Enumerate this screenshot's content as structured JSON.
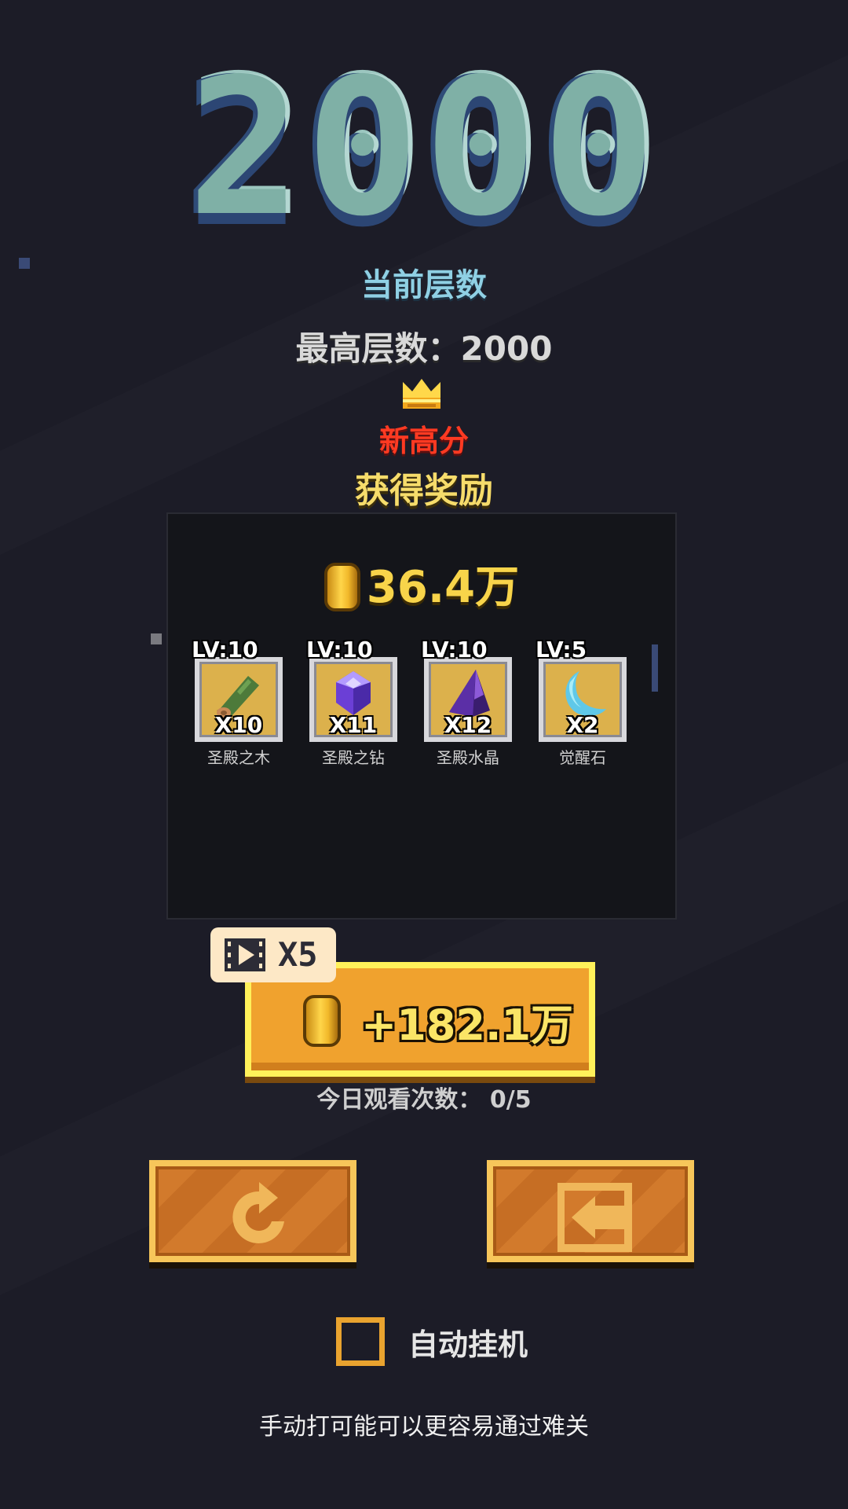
{
  "score": "2000",
  "labels": {
    "current_floor": "当前层数",
    "best_floor": "最高层数：2000",
    "new_high": "新高分",
    "reward_title": "获得奖励"
  },
  "rewards": {
    "coins": "36.4万",
    "items": [
      {
        "level": "LV:10",
        "qty": "X10",
        "name": "圣殿之木",
        "icon": "wood-log-icon"
      },
      {
        "level": "LV:10",
        "qty": "X11",
        "name": "圣殿之钻",
        "icon": "purple-gem-icon"
      },
      {
        "level": "LV:10",
        "qty": "X12",
        "name": "圣殿水晶",
        "icon": "dark-crystal-icon"
      },
      {
        "level": "LV:5",
        "qty": "X2",
        "name": "觉醒石",
        "icon": "crescent-stone-icon"
      }
    ]
  },
  "ad": {
    "badge": "X5",
    "button_label": "+182.1万",
    "watch_count": "今日观看次数：  0/5"
  },
  "auto": {
    "label": "自动挂机",
    "checked": false
  },
  "hint": "手动打可能可以更容易通过难关",
  "colors": {
    "background": "#1c1c27",
    "coin": "#f8d44a",
    "new_high": "#ff3a22",
    "button": "#f0a22e"
  }
}
